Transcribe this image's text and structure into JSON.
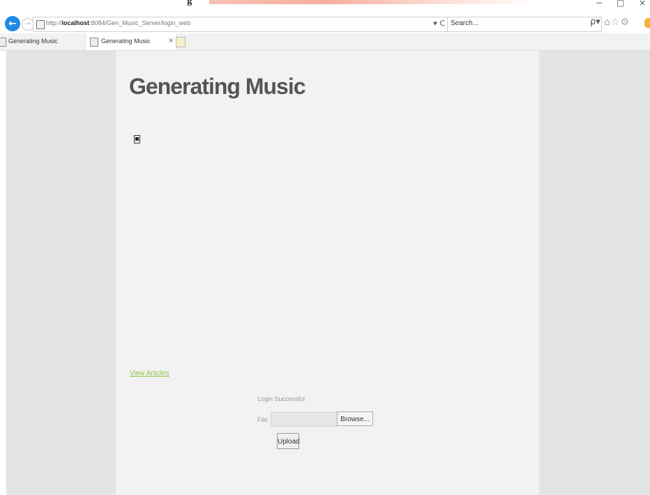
{
  "window": {
    "banner_text": "g",
    "minimize_glyph": "−",
    "restore_glyph": "□",
    "close_glyph": "×"
  },
  "toolbar": {
    "back_icon": "back-arrow-icon",
    "url_prefix": "http://",
    "url_host": "localhost",
    "url_rest": ":8084/Gen_Music_Server/login_web",
    "refresh_controls": "▾ C",
    "search_placeholder": "Search...",
    "search_icon_glyph": "ρ▾",
    "right_icons": "⌂☆⚙"
  },
  "tabs": [
    {
      "label": "Generating Music"
    },
    {
      "label": "Generating Music",
      "close": "×"
    }
  ],
  "page": {
    "title": "Generating Music",
    "view_link": "View Articles",
    "login_message": "Login Successful",
    "file_label": "File:",
    "browse_label": "Browse...",
    "upload_label": "Upload"
  },
  "colors": {
    "accent": "#1e88e5",
    "link": "#8bc34a",
    "content_bg": "#f2f2f2",
    "page_bg": "#e3e3e3"
  }
}
